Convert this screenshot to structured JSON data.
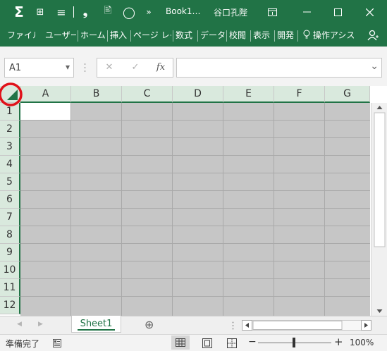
{
  "quick_access": {
    "autosum_glyph": "Σ",
    "grid_glyph": "⊞",
    "align_glyph": "≡",
    "comma_glyph": "❟",
    "preview_glyph": "🖹",
    "shape_glyph": "◯",
    "more_glyph": "»"
  },
  "window": {
    "title": "Book1…",
    "user": "谷口孔陛",
    "ribbon_display_glyph": "⊤",
    "minimize_glyph": "—",
    "maximize_glyph": "☐",
    "close_glyph": "✕"
  },
  "ribbon": {
    "tabs": [
      {
        "label": "ファイル"
      },
      {
        "label": "ユーザー"
      },
      {
        "label": "ホーム"
      },
      {
        "label": "挿入"
      },
      {
        "label": "ページ レイ"
      },
      {
        "label": "数式"
      },
      {
        "label": "データ"
      },
      {
        "label": "校閲"
      },
      {
        "label": "表示"
      },
      {
        "label": "開発"
      }
    ],
    "tell_me": "操作アシス",
    "share_glyph": "⚲"
  },
  "formula_bar": {
    "name_box_value": "A1",
    "name_box_arrow": "▾",
    "cancel_glyph": "✕",
    "enter_glyph": "✓",
    "fx_label": "fx",
    "expand_arrow": "⌄",
    "formula_value": ""
  },
  "sheet": {
    "columns": [
      "A",
      "B",
      "C",
      "D",
      "E",
      "F",
      "G"
    ],
    "rows": [
      "1",
      "2",
      "3",
      "4",
      "5",
      "6",
      "7",
      "8",
      "9",
      "10",
      "11",
      "12"
    ],
    "active_cell": "A1",
    "cell_fill": "#c6c6c6",
    "header_fill": "#d9e9dd",
    "accent": "#217346",
    "highlight_circle": "#e0121a"
  },
  "sheet_tabs": {
    "nav_prev": "◀",
    "nav_next": "▶",
    "tabs": [
      {
        "label": "Sheet1"
      }
    ],
    "add_glyph": "⊕"
  },
  "status_bar": {
    "ready_text": "準備完了",
    "zoom_out": "−",
    "zoom_in": "+",
    "zoom": "100%"
  }
}
